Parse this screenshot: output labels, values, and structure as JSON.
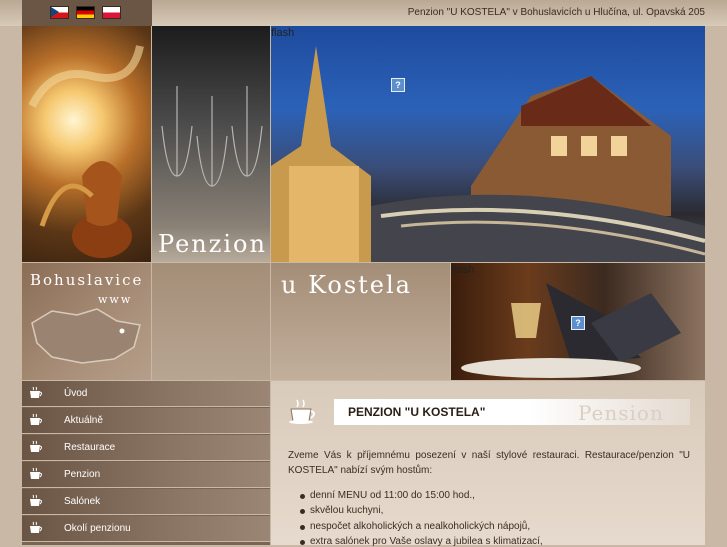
{
  "header": {
    "address": "Penzion \"U KOSTELA\" v Bohuslavicích u Hlučína, ul. Opavská 205",
    "languages": [
      {
        "name": "Czech",
        "colors": [
          "#ffffff",
          "#d7141a",
          "#11457e"
        ]
      },
      {
        "name": "German",
        "colors": [
          "#000000",
          "#dd0000",
          "#ffce00"
        ]
      },
      {
        "name": "Polish",
        "colors": [
          "#ffffff",
          "#dc143c"
        ]
      }
    ]
  },
  "banner": {
    "penzion_text": "Penzion",
    "kostela_text": "u Kostela",
    "bohuslavice_text": "Bohuslavice",
    "www_text": "www",
    "flash_label_1": "flash",
    "flash_label_2": "flash",
    "qmark": "?"
  },
  "menu": {
    "items": [
      {
        "label": "Úvod"
      },
      {
        "label": "Aktuálně"
      },
      {
        "label": "Restaurace"
      },
      {
        "label": "Penzion"
      },
      {
        "label": "Salónek"
      },
      {
        "label": "Okolí penzionu"
      }
    ]
  },
  "content": {
    "title": "PENZION \"U KOSTELA\"",
    "title_ghost": "Pension",
    "intro": "Zveme Vás k příjemnému posezení v naší stylové restauraci. Restaurace/penzion \"U KOSTELA\" nabízí svým hostům:",
    "bullets": [
      "denní MENU od 11:00 do 15:00 hod.,",
      "skvělou kuchyni,",
      "nespočet alkoholických a nealkoholických nápojů,",
      "extra salónek pro Vaše oslavy a jubilea s klimatizací,"
    ]
  },
  "colors": {
    "background": "#c9b8a5",
    "menu_dark": "#6a5444",
    "text": "#3b2c20"
  }
}
